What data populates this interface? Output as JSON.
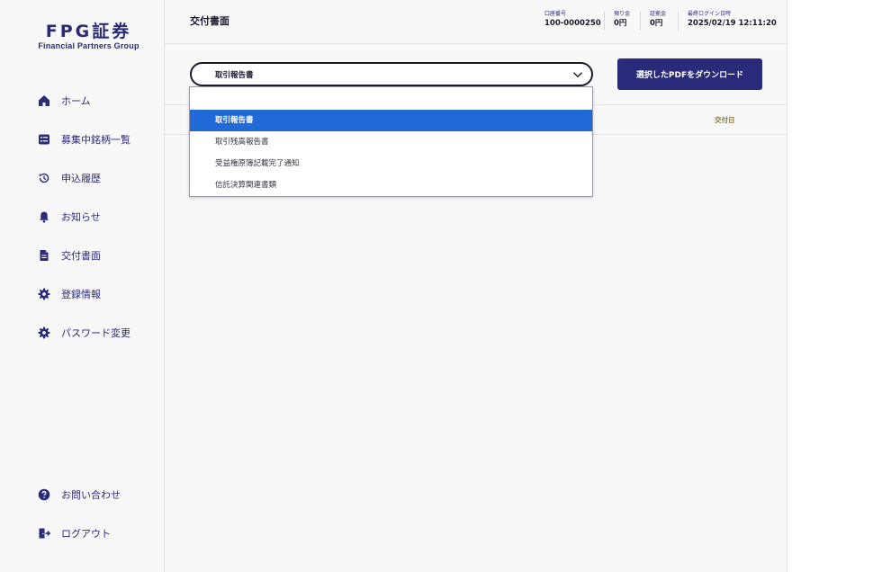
{
  "logo": {
    "main": "FPG証券",
    "sub": "Financial Partners Group"
  },
  "sidebar": {
    "items": [
      {
        "label": "ホーム",
        "icon": "home-icon"
      },
      {
        "label": "募集中銘柄一覧",
        "icon": "list-icon"
      },
      {
        "label": "申込履歴",
        "icon": "history-icon"
      },
      {
        "label": "お知らせ",
        "icon": "bell-icon"
      },
      {
        "label": "交付書面",
        "icon": "document-icon"
      },
      {
        "label": "登録情報",
        "icon": "gear-icon"
      },
      {
        "label": "パスワード変更",
        "icon": "gear-icon"
      }
    ],
    "bottom_items": [
      {
        "label": "お問い合わせ",
        "icon": "help-icon"
      },
      {
        "label": "ログアウト",
        "icon": "logout-icon"
      }
    ]
  },
  "header": {
    "title": "交付書面",
    "account_label": "口座番号",
    "account_value": "100-0000250",
    "deposit_label": "預り金",
    "deposit_value": "0円",
    "margin_label": "証拠金",
    "margin_value": "0円",
    "last_login_label": "最終ログイン日時",
    "last_login_value": "2025/02/19 12:11:20"
  },
  "main": {
    "select_value": "取引報告書",
    "download_button": "選択したPDFをダウンロード",
    "column_date": "交付日"
  },
  "dropdown": {
    "options": [
      "取引報告書",
      "取引残高報告書",
      "受益権原簿記載完了通知",
      "信託決算関連書類"
    ],
    "selected_index": 0
  },
  "colors": {
    "brand": "#2a2a7a",
    "selected_option": "#1f6ad6",
    "date_header": "#8a7a3a"
  }
}
